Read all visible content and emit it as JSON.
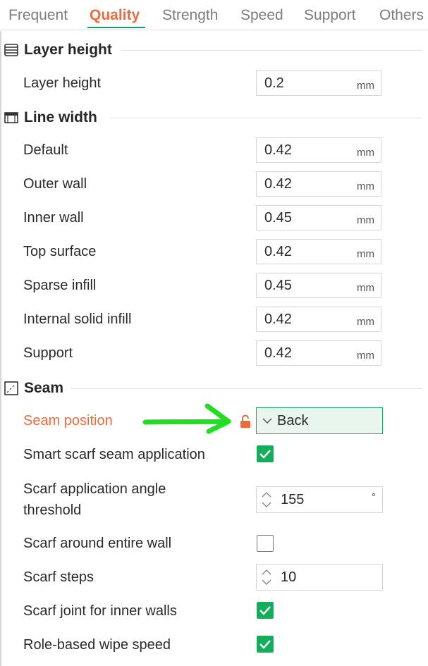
{
  "tabs": [
    {
      "label": "Frequent",
      "active": false
    },
    {
      "label": "Quality",
      "active": true
    },
    {
      "label": "Strength",
      "active": false
    },
    {
      "label": "Speed",
      "active": false
    },
    {
      "label": "Support",
      "active": false
    },
    {
      "label": "Others",
      "active": false
    }
  ],
  "sections": {
    "layer_height": {
      "title": "Layer height",
      "icon": "layer-height-icon"
    },
    "line_width": {
      "title": "Line width",
      "icon": "line-width-icon"
    },
    "seam": {
      "title": "Seam",
      "icon": "seam-icon"
    }
  },
  "layer_height": [
    {
      "label": "Layer height",
      "value": "0.2",
      "unit": "mm"
    }
  ],
  "line_width": [
    {
      "label": "Default",
      "value": "0.42",
      "unit": "mm"
    },
    {
      "label": "Outer wall",
      "value": "0.42",
      "unit": "mm"
    },
    {
      "label": "Inner wall",
      "value": "0.45",
      "unit": "mm"
    },
    {
      "label": "Top surface",
      "value": "0.42",
      "unit": "mm"
    },
    {
      "label": "Sparse infill",
      "value": "0.45",
      "unit": "mm"
    },
    {
      "label": "Internal solid infill",
      "value": "0.42",
      "unit": "mm"
    },
    {
      "label": "Support",
      "value": "0.42",
      "unit": "mm"
    }
  ],
  "seam": {
    "seam_position": {
      "label": "Seam position",
      "value": "Back",
      "modified": true
    },
    "smart_scarf": {
      "label": "Smart scarf seam application",
      "checked": true
    },
    "scarf_angle": {
      "label_line1": "Scarf application angle",
      "label_line2": "threshold",
      "value": "155",
      "unit": "°"
    },
    "scarf_entire_wall": {
      "label": "Scarf around entire wall",
      "checked": false
    },
    "scarf_steps": {
      "label": "Scarf steps",
      "value": "10"
    },
    "scarf_inner_walls": {
      "label": "Scarf joint for inner walls",
      "checked": true
    },
    "role_wipe_speed": {
      "label": "Role-based wipe speed",
      "checked": true
    }
  },
  "colors": {
    "accent_orange": "#ef6a3a",
    "accent_green": "#13ad5c",
    "tab_underline": "#159a6a",
    "annotation_arrow": "#22dd22"
  }
}
